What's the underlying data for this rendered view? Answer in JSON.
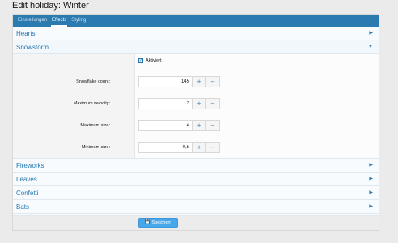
{
  "page_title": "Edit holiday: Winter",
  "tabs": [
    {
      "label": "Einstellungen"
    },
    {
      "label": "Effects"
    },
    {
      "label": "Styling"
    }
  ],
  "active_tab": "Effects",
  "sections": {
    "hearts": {
      "title": "Hearts",
      "expanded": false
    },
    "snowstorm": {
      "title": "Snowstorm",
      "expanded": true,
      "checkbox": {
        "label": "Aktiviert",
        "checked": true
      },
      "fields": [
        {
          "label": "Snowflake count:",
          "value": "145"
        },
        {
          "label": "Maximum velocity:",
          "value": "2"
        },
        {
          "label": "Maximum size:",
          "value": "4"
        },
        {
          "label": "Minimum size:",
          "value": "0,5"
        }
      ],
      "stepper": {
        "plus": "+",
        "minus": "−"
      }
    },
    "fireworks": {
      "title": "Fireworks",
      "expanded": false
    },
    "leaves": {
      "title": "Leaves",
      "expanded": false
    },
    "confetti": {
      "title": "Confetti",
      "expanded": false
    },
    "bats": {
      "title": "Bats",
      "expanded": false
    }
  },
  "icons": {
    "collapsed": "chevron-right-icon",
    "expanded": "chevron-down-icon",
    "save": "save-icon",
    "check": "checkmark-icon"
  },
  "save_button": {
    "label": "Speichern"
  },
  "colors": {
    "accent": "#2b7bb0",
    "link": "#2577b1",
    "button": "#47a7eb"
  }
}
